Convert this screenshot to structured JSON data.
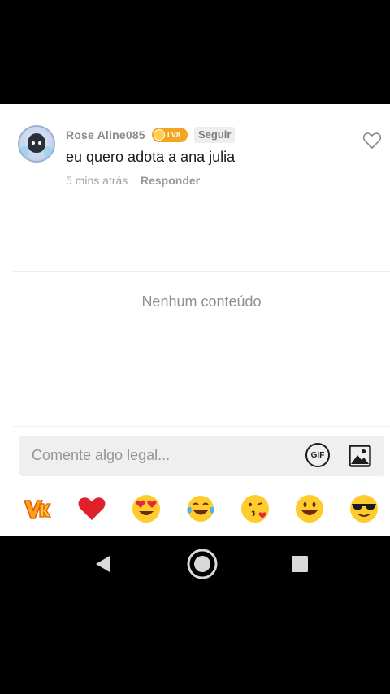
{
  "comment": {
    "username": "Rose Aline085",
    "level": "LV8",
    "follow_label": "Seguir",
    "text": "eu quero adota a ana julia",
    "time": "5 mins atrás",
    "reply_label": "Responder"
  },
  "empty_state": "Nenhum conteúdo",
  "input": {
    "placeholder": "Comente algo legal...",
    "gif_label": "GIF"
  },
  "emoji_bar": [
    "vk-sticker",
    "red-heart",
    "heart-eyes",
    "tears-of-joy",
    "blowing-kiss",
    "smiley",
    "sunglasses"
  ],
  "colors": {
    "accent_badge": "#f3a521",
    "heart": "#e0202a",
    "emoji_yellow": "#ffcb2d"
  }
}
